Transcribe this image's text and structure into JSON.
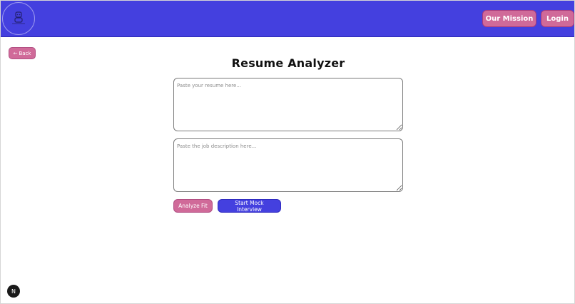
{
  "header": {
    "logo_icon": "mascot-logo-icon",
    "nav": {
      "mission_label": "Our Mission",
      "login_label": "Login"
    }
  },
  "back": {
    "arrow": "←",
    "label": "Back"
  },
  "main": {
    "title": "Resume Analyzer",
    "resume_placeholder": "Paste your resume here...",
    "job_placeholder": "Paste the job description here...",
    "resume_value": "",
    "job_value": "",
    "analyze_label": "Analyze Fit",
    "interview_label": "Start Mock Interview"
  },
  "dev_badge": {
    "letter": "N"
  },
  "colors": {
    "primary": "#4440df",
    "accent": "#d06a99",
    "text": "#111111"
  }
}
